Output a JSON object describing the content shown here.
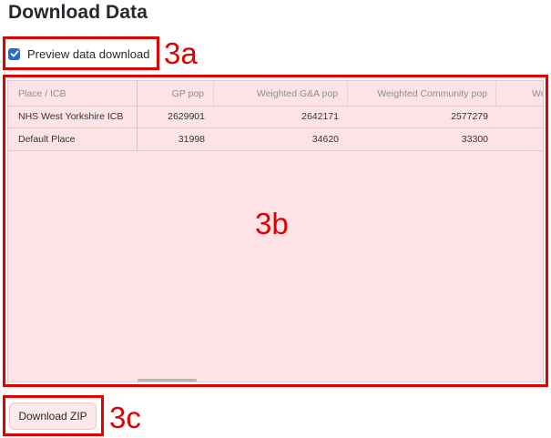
{
  "page": {
    "heading": "Download Data"
  },
  "preview": {
    "checkbox_label": "Preview data download",
    "checked": true
  },
  "table": {
    "columns": [
      "Place / ICB",
      "GP pop",
      "Weighted G&A pop",
      "Weighted Community pop",
      "We"
    ],
    "rows": [
      [
        "NHS West Yorkshire ICB",
        "2629901",
        "2642171",
        "2577279",
        ""
      ],
      [
        "Default Place",
        "31998",
        "34620",
        "33300",
        ""
      ]
    ]
  },
  "download": {
    "button_label": "Download ZIP"
  },
  "annotations": {
    "a": "3a",
    "b": "3b",
    "c": "3c",
    "color": "#e00000"
  },
  "colors": {
    "accent": "#1f6fd6",
    "table_bg": "#fde3e6"
  }
}
